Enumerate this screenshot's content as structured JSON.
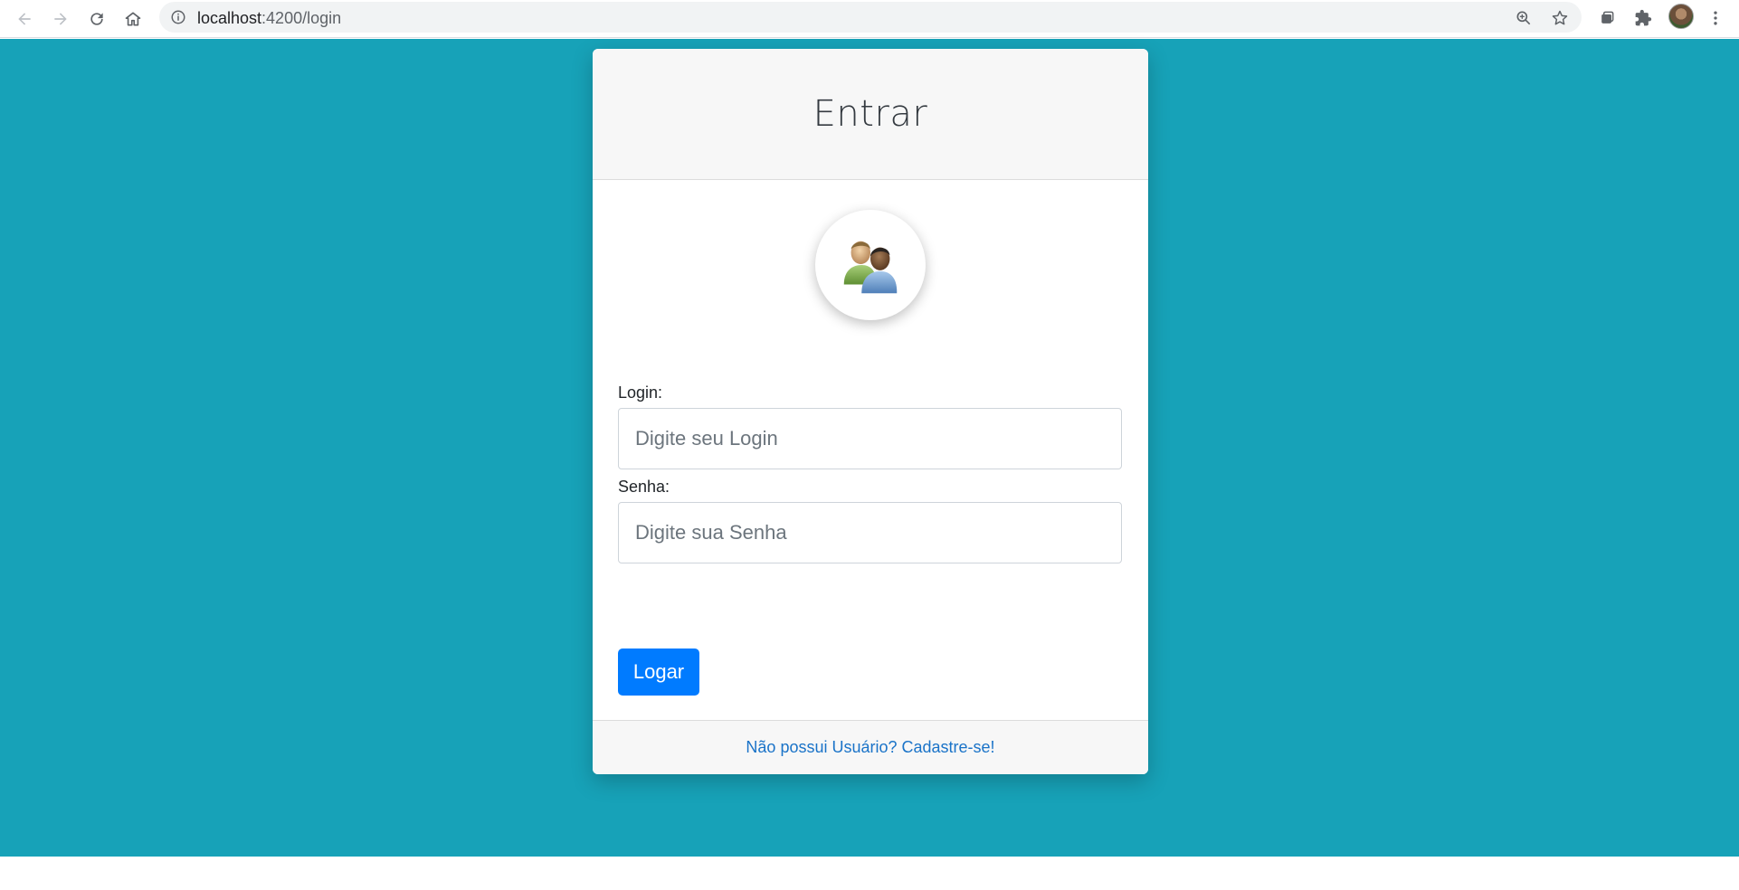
{
  "browser": {
    "url_host": "localhost",
    "url_path": ":4200/login",
    "icons": [
      "back-icon",
      "forward-icon",
      "reload-icon",
      "home-icon",
      "info-icon",
      "zoom-icon",
      "star-icon",
      "tab-search-icon",
      "extensions-icon",
      "profile-avatar",
      "menu-icon"
    ]
  },
  "login_card": {
    "title": "Entrar",
    "avatar_icon": "users-icon",
    "login_label": "Login:",
    "login_placeholder": "Digite seu Login",
    "login_value": "",
    "password_label": "Senha:",
    "password_placeholder": "Digite sua Senha",
    "password_value": "",
    "submit_label": "Logar",
    "signup_link": "Não possui Usuário? Cadastre-se!"
  },
  "colors": {
    "page_background": "#17a2b8",
    "primary_button": "#007bff",
    "link": "#1a73c8"
  }
}
